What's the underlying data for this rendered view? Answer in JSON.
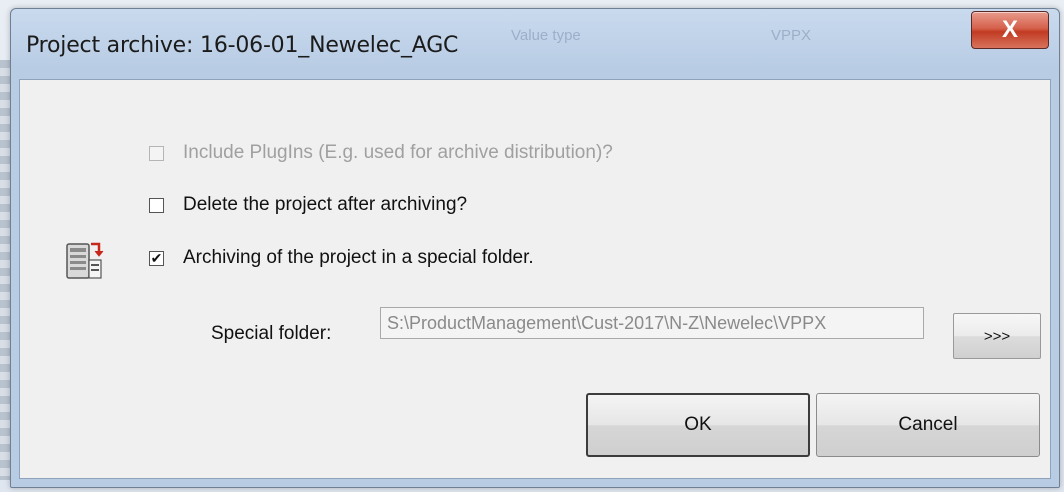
{
  "window": {
    "title": "Project archive: 16-06-01_Newelec_AGC",
    "close_glyph": "X",
    "bg_ghost_text": [
      "Value type",
      "VPPX"
    ]
  },
  "options": {
    "include_plugins": {
      "label": "Include PlugIns (E.g. used for archive distribution)?",
      "checked": false,
      "enabled": false
    },
    "delete_after": {
      "label": "Delete the project after archiving?",
      "checked": false,
      "enabled": true
    },
    "special_folder_archiving": {
      "label": "Archiving of the project in a special folder.",
      "checked": true,
      "enabled": true
    }
  },
  "special_folder": {
    "label": "Special folder:",
    "value": "S:\\ProductManagement\\Cust-2017\\N-Z\\Newelec\\VPPX",
    "browse_label": ">>>"
  },
  "buttons": {
    "ok_label": "OK",
    "cancel_label": "Cancel"
  },
  "colors": {
    "close_button": "#c9412a",
    "window_frame": "#b8cce4",
    "client_bg": "#f0f0f0"
  },
  "icons": {
    "close": "close-icon",
    "archive": "server-archive-icon",
    "check": "checkmark-icon"
  }
}
